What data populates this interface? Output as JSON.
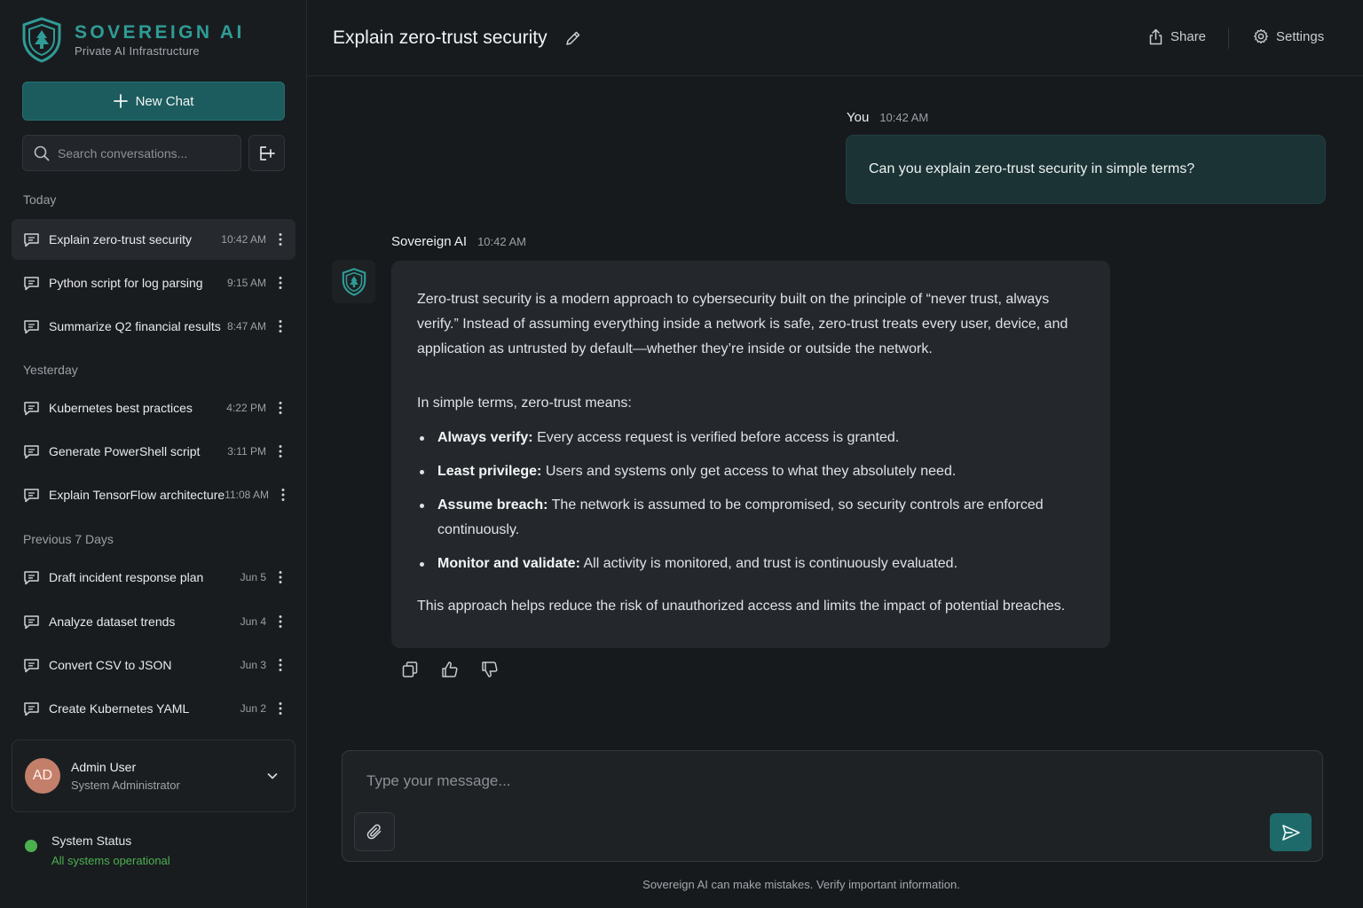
{
  "brand": {
    "name": "SOVEREIGN AI",
    "tagline": "Private AI Infrastructure",
    "accent_color": "#2f9c96"
  },
  "sidebar": {
    "new_chat_label": "New Chat",
    "search_placeholder": "Search conversations...",
    "sections": [
      {
        "label": "Today",
        "items": [
          {
            "title": "Explain zero-trust security",
            "time": "10:42 AM",
            "active": true
          },
          {
            "title": "Python script for log parsing",
            "time": "9:15 AM"
          },
          {
            "title": "Summarize Q2 financial results",
            "time": "8:47 AM"
          }
        ]
      },
      {
        "label": "Yesterday",
        "items": [
          {
            "title": "Kubernetes best practices",
            "time": "4:22 PM"
          },
          {
            "title": "Generate PowerShell script",
            "time": "3:11 PM"
          },
          {
            "title": "Explain TensorFlow architecture",
            "time": "11:08 AM"
          }
        ]
      },
      {
        "label": "Previous 7 Days",
        "items": [
          {
            "title": "Draft incident response plan",
            "time": "Jun 5"
          },
          {
            "title": "Analyze dataset trends",
            "time": "Jun 4"
          },
          {
            "title": "Convert CSV to JSON",
            "time": "Jun 3"
          },
          {
            "title": "Create Kubernetes YAML",
            "time": "Jun 2"
          }
        ]
      }
    ],
    "user": {
      "initials": "AD",
      "name": "Admin User",
      "role": "System Administrator"
    },
    "system_status": {
      "title": "System Status",
      "message": "All systems operational",
      "color": "#4caf50"
    }
  },
  "header": {
    "title": "Explain zero-trust security",
    "share_label": "Share",
    "settings_label": "Settings"
  },
  "chat": {
    "user_message": {
      "author": "You",
      "time": "10:42 AM",
      "text": "Can you explain zero-trust security in simple terms?"
    },
    "ai_message": {
      "author": "Sovereign AI",
      "time": "10:42 AM",
      "intro": "Zero-trust security is a modern approach to cybersecurity built on the principle of “never trust, always verify.” Instead of assuming everything inside a network is safe, zero-trust treats every user, device, and application as untrusted by default—whether they’re inside or outside the network.",
      "lead": "In simple terms, zero-trust means:",
      "bullets": [
        {
          "term": "Always verify:",
          "text": "Every access request is verified before access is granted."
        },
        {
          "term": "Least privilege:",
          "text": "Users and systems only get access to what they absolutely need."
        },
        {
          "term": "Assume breach:",
          "text": "The network is assumed to be compromised, so security controls are enforced continuously."
        },
        {
          "term": "Monitor and validate:",
          "text": "All activity is monitored, and trust is continuously evaluated."
        }
      ],
      "conclusion": "This approach helps reduce the risk of unauthorized access and limits the impact of potential breaches."
    }
  },
  "composer": {
    "placeholder": "Type your message...",
    "disclaimer": "Sovereign AI can make mistakes. Verify important information."
  },
  "icons": {
    "logo": "shield-tree-icon",
    "new_chat": "plus-icon",
    "search": "search-icon",
    "export": "export-icon",
    "conversation": "chat-bubble-icon",
    "more": "more-vertical-icon",
    "edit": "pencil-icon",
    "share": "share-icon",
    "settings": "gear-icon",
    "copy": "copy-icon",
    "like": "thumbs-up-icon",
    "dislike": "thumbs-down-icon",
    "attach": "paperclip-icon",
    "send": "send-icon",
    "user_menu": "chevron-down-icon"
  }
}
